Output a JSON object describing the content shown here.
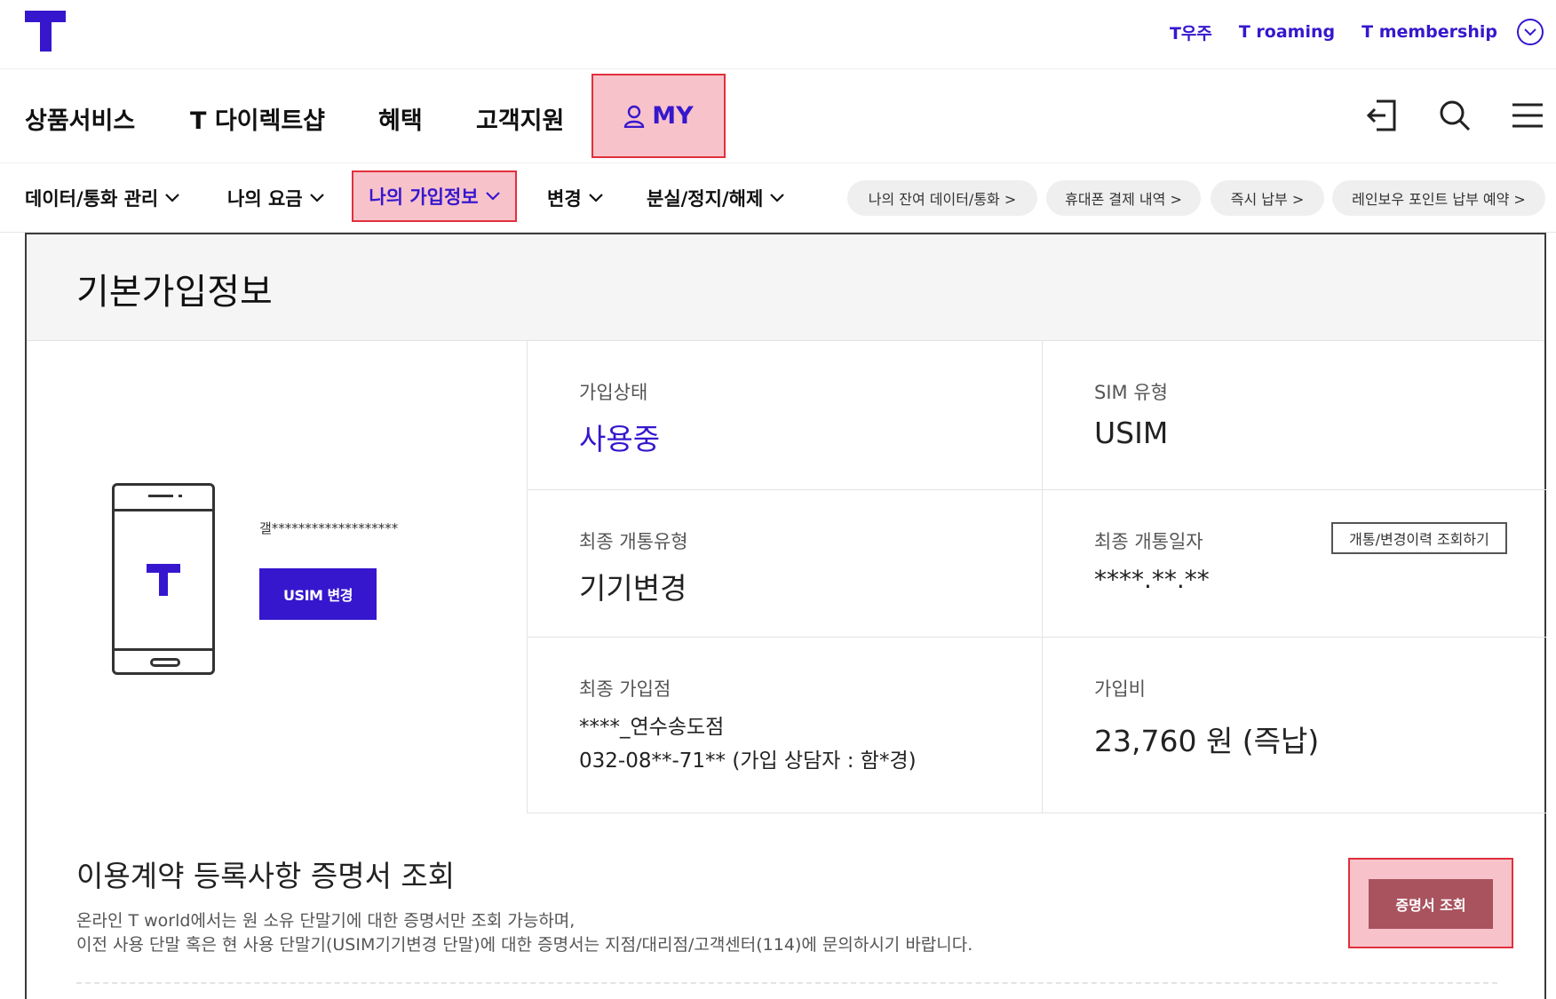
{
  "colors": {
    "brand": "#3617ce",
    "highlight_fill": "#f8c2ca",
    "highlight_border": "#e0303d",
    "cert_button": "#a9535e"
  },
  "top_links": [
    "T우주",
    "T roaming",
    "T membership"
  ],
  "main_nav": {
    "items": [
      "상품서비스",
      "T 다이렉트샵",
      "혜택",
      "고객지원"
    ],
    "my_label": "MY"
  },
  "sub_nav": {
    "items": [
      "데이터/통화 관리",
      "나의 요금"
    ],
    "active": "나의 가입정보",
    "items_after": [
      "변경",
      "분실/정지/해제"
    ],
    "quick_links": [
      "나의 잔여 데이터/통화 >",
      "휴대폰 결제 내역 >",
      "즉시 납부 >",
      "레인보우 포인트 납부 예약 >"
    ]
  },
  "card": {
    "title": "기본가입정보",
    "device_name": "갤*******************",
    "usim_button": "USIM 변경",
    "fields": {
      "status_label": "가입상태",
      "status_value": "사용중",
      "sim_label": "SIM 유형",
      "sim_value": "USIM",
      "open_type_label": "최종 개통유형",
      "open_type_value": "기기변경",
      "open_date_label": "최종 개통일자",
      "open_date_value": "****.**.**",
      "history_button": "개통/변경이력 조회하기",
      "store_label": "최종 가입점",
      "store_name": "****_연수송도점",
      "store_phone": "032-08**-71** (가입 상담자 : 함*경)",
      "fee_label": "가입비",
      "fee_value": "23,760 원 (즉납)"
    }
  },
  "certificate": {
    "title": "이용계약 등록사항 증명서 조회",
    "desc_line1": "온라인 T world에서는 원 소유 단말기에 대한 증명서만 조회 가능하며,",
    "desc_line2": "이전 사용 단말 혹은 현 사용 단말기(USIM기기변경 단말)에 대한 증명서는 지점/대리점/고객센터(114)에 문의하시기 바랍니다.",
    "button": "증명서 조회"
  }
}
